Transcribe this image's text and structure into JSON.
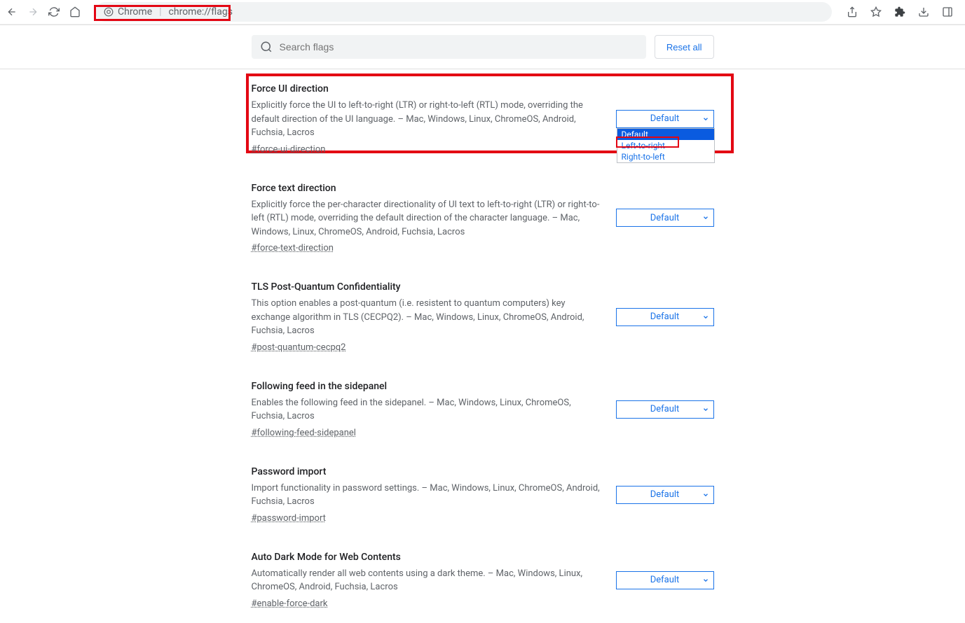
{
  "address": {
    "scheme_label": "Chrome",
    "url": "chrome://flags"
  },
  "search": {
    "placeholder": "Search flags"
  },
  "reset_label": "Reset all",
  "dropdown_options": [
    "Default",
    "Left-to-right",
    "Right-to-left"
  ],
  "select_default": "Default",
  "flags": [
    {
      "title": "Force UI direction",
      "desc": "Explicitly force the UI to left-to-right (LTR) or right-to-left (RTL) mode, overriding the default direction of the UI language. – Mac, Windows, Linux, ChromeOS, Android, Fuchsia, Lacros",
      "anchor": "#force-ui-direction"
    },
    {
      "title": "Force text direction",
      "desc": "Explicitly force the per-character directionality of UI text to left-to-right (LTR) or right-to-left (RTL) mode, overriding the default direction of the character language. – Mac, Windows, Linux, ChromeOS, Android, Fuchsia, Lacros",
      "anchor": "#force-text-direction"
    },
    {
      "title": "TLS Post-Quantum Confidentiality",
      "desc": "This option enables a post-quantum (i.e. resistent to quantum computers) key exchange algorithm in TLS (CECPQ2). – Mac, Windows, Linux, ChromeOS, Android, Fuchsia, Lacros",
      "anchor": "#post-quantum-cecpq2"
    },
    {
      "title": "Following feed in the sidepanel",
      "desc": "Enables the following feed in the sidepanel. – Mac, Windows, Linux, ChromeOS, Fuchsia, Lacros",
      "anchor": "#following-feed-sidepanel"
    },
    {
      "title": "Password import",
      "desc": "Import functionality in password settings. – Mac, Windows, Linux, ChromeOS, Android, Fuchsia, Lacros",
      "anchor": "#password-import"
    },
    {
      "title": "Auto Dark Mode for Web Contents",
      "desc": "Automatically render all web contents using a dark theme. – Mac, Windows, Linux, ChromeOS, Android, Fuchsia, Lacros",
      "anchor": "#enable-force-dark"
    }
  ]
}
